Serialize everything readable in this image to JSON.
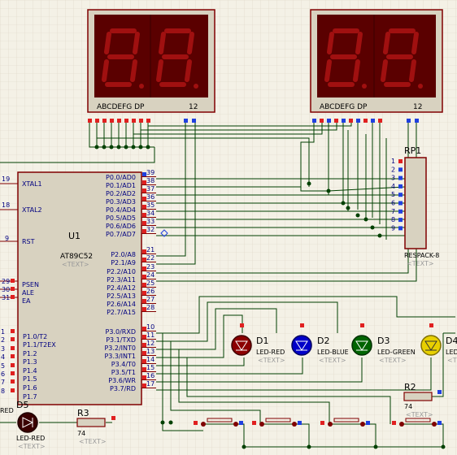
{
  "colors": {
    "background": "#f4f1e6",
    "grid": "#dcd6c4",
    "chip_fill": "#d8d2c0",
    "chip_border": "#800000",
    "wire": "#004000",
    "pin_text": "#000080",
    "component_text": "#000000",
    "template_text": "#9a9a9a",
    "led_red": "#8b0000",
    "led_blue": "#0000c8",
    "led_green": "#006400",
    "led_yellow": "#e8d000",
    "segment_body": "#5a0000",
    "segment_off": "#a01010"
  },
  "displays": [
    {
      "pin_label": "ABCDEFG  DP",
      "digit_pins": "12"
    },
    {
      "pin_label": "ABCDEFG  DP",
      "digit_pins": "12"
    }
  ],
  "mcu": {
    "ref": "U1",
    "part": "AT89C52",
    "text_placeholder": "<TEXT>",
    "left_pins": [
      {
        "num": "19",
        "label": "XTAL1"
      },
      {
        "num": "18",
        "label": "XTAL2"
      },
      {
        "num": "9",
        "label": "RST"
      },
      {
        "num": "29",
        "label": "PSEN"
      },
      {
        "num": "30",
        "label": "ALE"
      },
      {
        "num": "31",
        "label": "EA"
      },
      {
        "num": "1",
        "label": "P1.0/T2"
      },
      {
        "num": "2",
        "label": "P1.1/T2EX"
      },
      {
        "num": "3",
        "label": "P1.2"
      },
      {
        "num": "4",
        "label": "P1.3"
      },
      {
        "num": "5",
        "label": "P1.4"
      },
      {
        "num": "6",
        "label": "P1.5"
      },
      {
        "num": "7",
        "label": "P1.6"
      },
      {
        "num": "8",
        "label": "P1.7"
      }
    ],
    "right_pins": [
      {
        "num": "39",
        "label": "P0.0/AD0"
      },
      {
        "num": "38",
        "label": "P0.1/AD1"
      },
      {
        "num": "37",
        "label": "P0.2/AD2"
      },
      {
        "num": "36",
        "label": "P0.3/AD3"
      },
      {
        "num": "35",
        "label": "P0.4/AD4"
      },
      {
        "num": "34",
        "label": "P0.5/AD5"
      },
      {
        "num": "33",
        "label": "P0.6/AD6"
      },
      {
        "num": "32",
        "label": "P0.7/AD7"
      },
      {
        "num": "21",
        "label": "P2.0/A8"
      },
      {
        "num": "22",
        "label": "P2.1/A9"
      },
      {
        "num": "23",
        "label": "P2.2/A10"
      },
      {
        "num": "24",
        "label": "P2.3/A11"
      },
      {
        "num": "25",
        "label": "P2.4/A12"
      },
      {
        "num": "26",
        "label": "P2.5/A13"
      },
      {
        "num": "27",
        "label": "P2.6/A14"
      },
      {
        "num": "28",
        "label": "P2.7/A15"
      },
      {
        "num": "10",
        "label": "P3.0/RXD"
      },
      {
        "num": "11",
        "label": "P3.1/TXD"
      },
      {
        "num": "12",
        "label": "P3.2/INT0"
      },
      {
        "num": "13",
        "label": "P3.3/INT1"
      },
      {
        "num": "14",
        "label": "P3.4/T0"
      },
      {
        "num": "15",
        "label": "P3.5/T1"
      },
      {
        "num": "16",
        "label": "P3.6/WR"
      },
      {
        "num": "17",
        "label": "P3.7/RD"
      }
    ]
  },
  "respack": {
    "ref": "RP1",
    "part": "RESPACK-8",
    "text_placeholder": "<TEXT>",
    "pins": [
      "1",
      "2",
      "3",
      "4",
      "5",
      "6",
      "7",
      "8",
      "9"
    ]
  },
  "leds": [
    {
      "ref": "D1",
      "part": "LED-RED",
      "text": "<TEXT>",
      "color": "#8b0000"
    },
    {
      "ref": "D2",
      "part": "LED-BLUE",
      "text": "<TEXT>",
      "color": "#0000c8"
    },
    {
      "ref": "D3",
      "part": "LED-GREEN",
      "text": "<TEXT>",
      "color": "#006400"
    },
    {
      "ref": "D4",
      "part": "LED",
      "text": "<TEXT>",
      "color": "#e8d000"
    }
  ],
  "d5": {
    "ref": "D5",
    "part": "LED-RED",
    "text": "<TEXT>",
    "left_fragment": "RED"
  },
  "resistors": [
    {
      "ref": "R3",
      "value": "74",
      "text": "<TEXT>"
    },
    {
      "ref": "R2",
      "value": "74",
      "text": "<TEXT>"
    }
  ]
}
